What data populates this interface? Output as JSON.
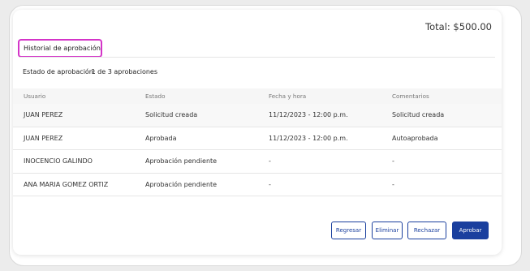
{
  "total_label": "Total: $500.00",
  "section_title": "Historial de aprobación",
  "status": {
    "label": "Estado de aprobación:",
    "value": "1 de 3 aprobaciones"
  },
  "table": {
    "headers": [
      "Usuario",
      "Estado",
      "Fecha y hora",
      "Comentarios"
    ],
    "rows": [
      [
        "JUAN PEREZ",
        "Solicitud creada",
        "11/12/2023 - 12:00 p.m.",
        "Solicitud creada"
      ],
      [
        "JUAN PEREZ",
        "Aprobada",
        "11/12/2023 - 12:00 p.m.",
        "Autoaprobada"
      ],
      [
        "INOCENCIO GALINDO",
        "Aprobación pendiente",
        "-",
        "-"
      ],
      [
        "ANA MARIA GOMEZ ORTIZ",
        "Aprobación pendiente",
        "-",
        "-"
      ]
    ]
  },
  "actions": {
    "back": "Regresar",
    "delete": "Eliminar",
    "reject": "Rechazar",
    "approve": "Aprobar"
  },
  "colors": {
    "accent": "#1a3f9e",
    "highlight_border": "#d434c8"
  }
}
